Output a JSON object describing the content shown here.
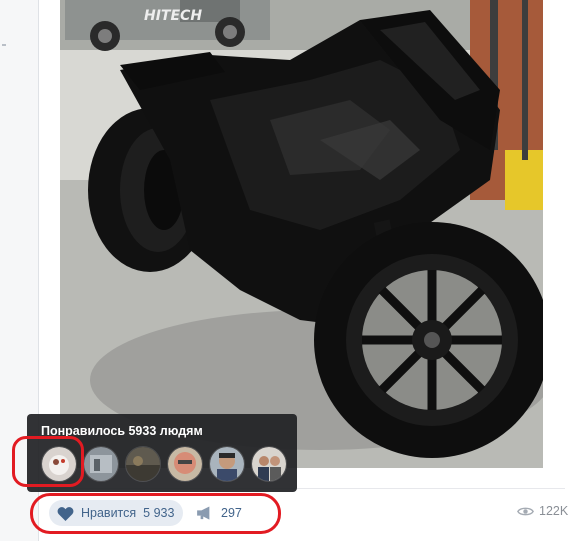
{
  "post": {
    "photo_alt": "black motorcycle photo",
    "watermark": "HITECH"
  },
  "likes_popup": {
    "title": "Понравилось 5933 людям",
    "avatars": [
      "user-1",
      "user-2",
      "user-3",
      "user-4",
      "user-5",
      "user-6"
    ]
  },
  "actions": {
    "like_label": "Нравится",
    "like_count": "5 933",
    "share_count": "297",
    "views_count": "122K"
  },
  "colors": {
    "accent": "#42648b",
    "annotation": "#e21b22",
    "like_button_bg": "#e6ebf2"
  },
  "icons": {
    "like": "heart-icon",
    "share": "megaphone-icon",
    "views": "eye-icon"
  }
}
